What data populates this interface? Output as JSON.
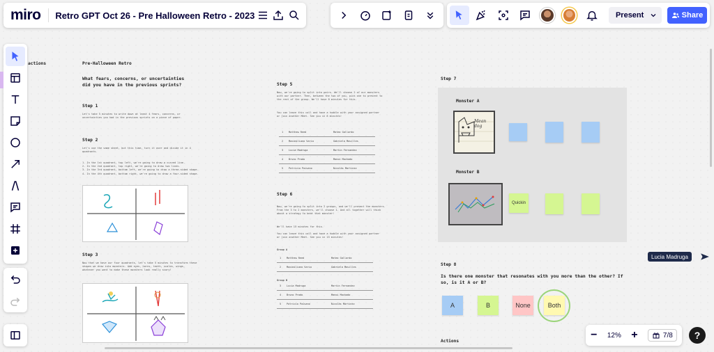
{
  "header": {
    "logo": "miro",
    "board_title": "Retro GPT Oct 26 - Pre Halloween Retro - 2023",
    "present_label": "Present",
    "share_label": "Share"
  },
  "canvas": {
    "col1": {
      "partial_label": "actions",
      "title": "Pre-Halloween Retro",
      "question": "What fears, concerns, or uncertainties did you have in the previous sprints?",
      "step1_title": "Step 1",
      "step1_text": "Let's take 5 minutes to write down at least 4 fears, concerns, or uncertainties you had in the previous sprints on a piece of paper.",
      "step2_title": "Step 2",
      "step2_text": "Let's use the same sheet, but this time, turn it over and divide it in 4 quadrants.",
      "step2_list": [
        "1. In the 1st quadrant, top left, we're going to draw a curved line.",
        "2. In the 2nd quadrant, top right, we're going to draw two lines.",
        "3. In the 3rd quadrant, bottom left, we're going to draw a three-sided shape.",
        "4. In the 4th quadrant, bottom right, we're going to draw a four-sided shape."
      ],
      "step3_title": "Step 3",
      "step3_text": "Now that we have our four quadrants, let's take 5 minutes to transform these shapes we drew into monsters. Add eyes, horns, teeth, scales, wings, whatever you want to make these monsters look really scary!"
    },
    "col2": {
      "step5_title": "Step 5",
      "step5_text1": "Now, we're going to split into pairs. We'll choose 2 of our monsters with our partner. Then, between the two of you, pick one to present to the rest of the group. We'll have 8 minutes for this.",
      "step5_text2": "You can leave this call and have a huddle with your assigned partner or join another Meet. See you in 8 minutes!",
      "pairs": [
        [
          "1",
          "Matthew Reed",
          "Mateo Gallardo"
        ],
        [
          "2",
          "Maximiliano Varia",
          "Gabriela Mosilles"
        ],
        [
          "3",
          "Lucia Madruga",
          "Martin Fernandez"
        ],
        [
          "4",
          "Bruno Prado",
          "Manoi Machado"
        ],
        [
          "5",
          "Patricia Paisano",
          "Nicolás Martinez"
        ]
      ],
      "step6_title": "Step 6",
      "step6_text1": "Now, we're going to split into 2 groups, and we'll present the monsters. From the 3 to 2 monsters, we'll choose 1. And all together will think about a strategy to beat that monster!",
      "step6_text2": "We'll have 15 minutes for this.",
      "step6_text3": "You can leave this call and have a huddle with your assigned partner or join another Meet. See you in 15 minutes!",
      "group_a_label": "Group A",
      "group_a": [
        [
          "1",
          "Matthew Reed",
          "Mateo Gallardo"
        ],
        [
          "2",
          "Maximiliano Varia",
          "Gabriela Mosilles"
        ]
      ],
      "group_b_label": "Group B",
      "group_b": [
        [
          "3",
          "Lucia Madruga",
          "Martin Fernandez"
        ],
        [
          "4",
          "Bruno Prado",
          "Manoi Machado"
        ],
        [
          "5",
          "Patricia Paisano",
          "Nicolás Martinez"
        ]
      ]
    },
    "col3": {
      "step7_title": "Step 7",
      "monster_a_label": "Monster A",
      "monster_a_drawing_text": "Mean dog",
      "monster_b_label": "Monster B",
      "monster_b_sticky": "Quickin",
      "step8_title": "Step 8",
      "step8_question": "Is there one monster that resonates with you more than the other? If so, is it A or B?",
      "vote_a": "A",
      "vote_b": "B",
      "vote_none": "None",
      "vote_both": "Both",
      "actions_label": "Actions"
    },
    "cursor_label": "Lucia Madruga"
  },
  "footer": {
    "zoom": "12%",
    "timer": "7/8",
    "help": "?"
  },
  "colors": {
    "accent": "#4262ff",
    "sticky_blue": "#a6ccf5",
    "sticky_green": "#d5f692",
    "sticky_pink": "#ffc6c6",
    "sticky_yellow": "#fff9b1"
  }
}
